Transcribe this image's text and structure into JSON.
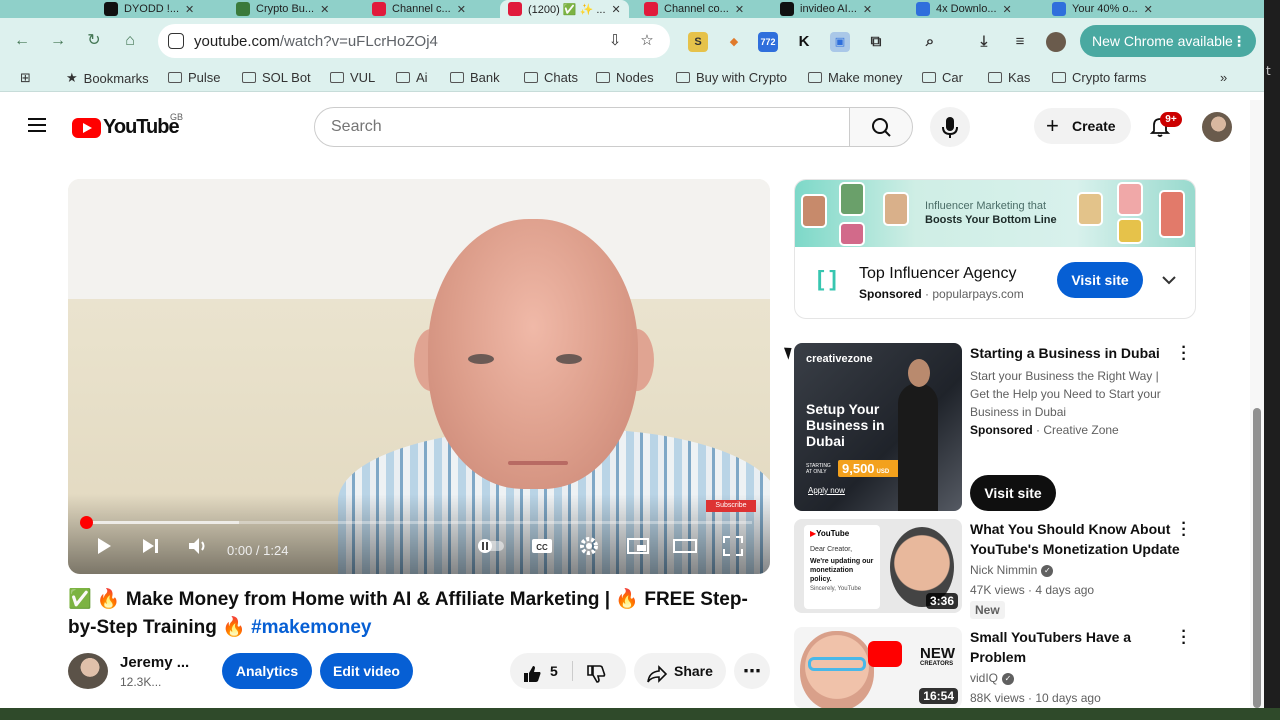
{
  "browser": {
    "tabs": [
      {
        "label": "DYODD !...",
        "color": "#111111"
      },
      {
        "label": "Crypto Bu...",
        "color": "#3b7a3b"
      },
      {
        "label": "Channel c...",
        "color": "#e01b3c"
      },
      {
        "label": "(1200) ✅ ✨ ...",
        "color": "#e01b3c",
        "active": true
      },
      {
        "label": "Channel co...",
        "color": "#e01b3c"
      },
      {
        "label": "invideo AI...",
        "color": "#111111"
      },
      {
        "label": "4x Downlo...",
        "color": "#2f6fdc"
      },
      {
        "label": "Your 40% o...",
        "color": "#2f6fdc"
      }
    ],
    "url_host": "youtube.com",
    "url_path": "/watch?v=uFLcrHoZOj4",
    "extension_badge": "772",
    "new_chrome_label": "New Chrome available",
    "bookmarks": [
      "Bookmarks",
      "Pulse",
      "SOL Bot",
      "VUL",
      "Ai",
      "Bank",
      "Chats",
      "Nodes",
      "Buy with Crypto",
      "Make money",
      "Car",
      "Kas",
      "Crypto farms"
    ]
  },
  "header": {
    "logo_text": "YouTube",
    "region": "GB",
    "search_placeholder": "Search",
    "create_label": "Create",
    "notifications_badge": "9+"
  },
  "player": {
    "time": "0:00 / 1:24",
    "played_fraction": 0.0,
    "buffered_fraction": 0.23,
    "watermark": "Subscribe"
  },
  "video": {
    "title_prefix": "✅ 🔥 Make Money from Home with AI & Affiliate Marketing | 🔥 FREE Step-by-Step Training 🔥 ",
    "title_hashtag": "#makemoney",
    "channel_name": "Jeremy ...",
    "channel_subs": "12.3K...",
    "analytics_label": "Analytics",
    "edit_label": "Edit video",
    "likes": "5",
    "share_label": "Share"
  },
  "ad": {
    "banner_line1": "Influencer Marketing that",
    "banner_line2": "Boosts Your Bottom Line",
    "title": "Top Influencer Agency",
    "sponsored": "Sponsored",
    "domain": "popularpays.com",
    "visit_label": "Visit site"
  },
  "sponsored_video": {
    "title": "Starting a Business in Dubai",
    "description": "Start your Business the Right Way | Get the Help you Need to Start your Business in Dubai",
    "sponsored": "Sponsored",
    "advertiser": "Creative Zone",
    "visit_label": "Visit site",
    "thumb_brand": "creativezone",
    "thumb_headline": "Setup Your Business in Dubai",
    "thumb_price_label": "STARTING AT ONLY",
    "thumb_price": "9,500",
    "thumb_currency": "USD",
    "thumb_cta": "Apply now"
  },
  "recommendations": [
    {
      "title": "What You Should Know About YouTube's Monetization Update",
      "channel": "Nick Nimmin",
      "views": "47K views",
      "age": "4 days ago",
      "duration": "3:36",
      "new": "New",
      "thumb_lines": [
        "Dear Creator,",
        "We're updating our monetization policy.",
        "Sincerely, YouTube"
      ]
    },
    {
      "title": "Small YouTubers Have a Problem",
      "channel": "vidIQ",
      "views": "88K views",
      "age": "10 days ago",
      "duration": "16:54",
      "thumb_text": "NEW",
      "thumb_sub": "CREATORS"
    }
  ]
}
